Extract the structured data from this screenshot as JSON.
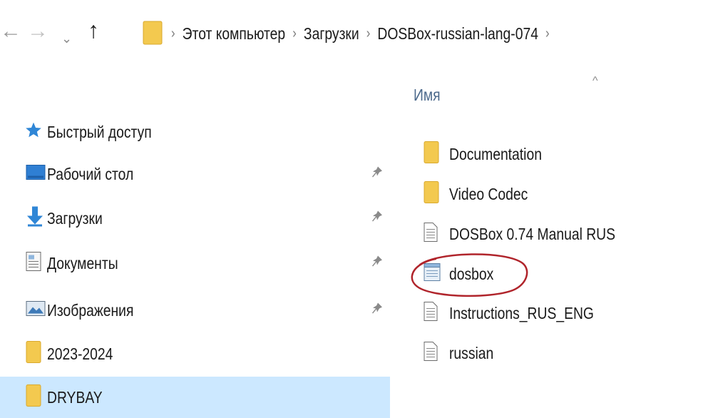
{
  "toolbar": {
    "back_glyph": "←",
    "forward_glyph": "→",
    "recent_glyph": "⌄",
    "up_glyph": "↑"
  },
  "address_bar": {
    "separator": "›",
    "crumbs": [
      "Этот компьютер",
      "Загрузки",
      "DOSBox-russian-lang-074"
    ]
  },
  "sidebar": {
    "items": [
      {
        "label": "Быстрый доступ",
        "icon": "star-icon"
      },
      {
        "label": "Рабочий стол",
        "icon": "desktop-icon",
        "pinned": true
      },
      {
        "label": "Загрузки",
        "icon": "download-arrow-icon",
        "pinned": true
      },
      {
        "label": "Документы",
        "icon": "documents-icon",
        "pinned": true
      },
      {
        "label": "Изображения",
        "icon": "pictures-icon",
        "pinned": true
      },
      {
        "label": "2023-2024",
        "icon": "folder-icon"
      },
      {
        "label": "DRYBAY",
        "icon": "folder-icon",
        "selected": true
      }
    ]
  },
  "file_list": {
    "sort_caret": "^",
    "column_name": "Имя",
    "items": [
      {
        "name": "Documentation",
        "icon": "folder-icon"
      },
      {
        "name": "Video Codec",
        "icon": "folder-icon"
      },
      {
        "name": "DOSBox 0.74 Manual RUS",
        "icon": "text-file-icon"
      },
      {
        "name": "dosbox",
        "icon": "config-file-icon",
        "highlighted": true
      },
      {
        "name": "Instructions_RUS_ENG",
        "icon": "text-file-icon"
      },
      {
        "name": "russian",
        "icon": "text-file-icon"
      }
    ]
  },
  "colors": {
    "selected_background": "#cce8ff",
    "folder": "#f3c94f",
    "annotation": "#b0242b",
    "column_header": "#4d6a8c"
  }
}
